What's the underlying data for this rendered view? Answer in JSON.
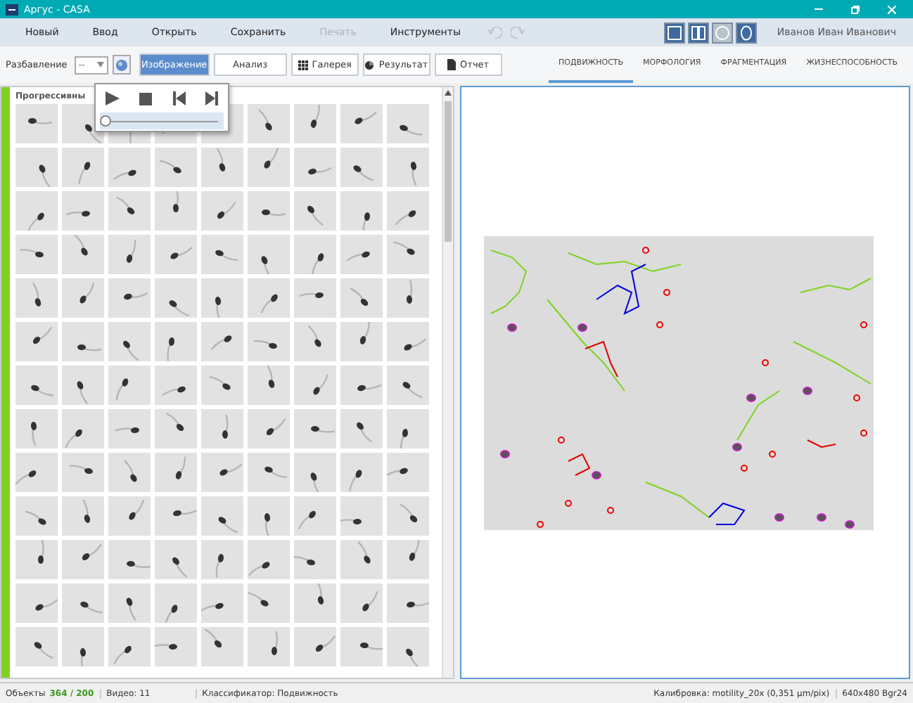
{
  "window": {
    "title": "Аргус - CASA"
  },
  "menu": [
    {
      "label": "Новый",
      "disabled": false
    },
    {
      "label": "Ввод",
      "disabled": false
    },
    {
      "label": "Открыть",
      "disabled": false
    },
    {
      "label": "Сохранить",
      "disabled": false
    },
    {
      "label": "Печать",
      "disabled": true
    },
    {
      "label": "Инструменты",
      "disabled": false
    }
  ],
  "history": {
    "undo_disabled": true,
    "redo_disabled": true
  },
  "view_modes": [
    {
      "kind": "single",
      "selected": true
    },
    {
      "kind": "split",
      "selected": true
    },
    {
      "kind": "circle",
      "selected": false
    },
    {
      "kind": "oval",
      "selected": true
    }
  ],
  "user": "Иванов Иван Иванович",
  "toolbar": {
    "dilution_label": "Разбавление",
    "dilution_value": "--",
    "buttons": [
      {
        "label": "Изображение",
        "kind": "plain",
        "selected": true
      },
      {
        "label": "Анализ",
        "kind": "plain",
        "selected": false
      },
      {
        "label": "Галерея",
        "kind": "grid",
        "selected": false
      },
      {
        "label": "Результат",
        "kind": "pie",
        "selected": false
      },
      {
        "label": "Отчет",
        "kind": "doc",
        "selected": false
      }
    ]
  },
  "tabs": [
    {
      "label": "ПОДВИЖНОСТЬ",
      "selected": true
    },
    {
      "label": "МОРФОЛОГИЯ",
      "selected": false
    },
    {
      "label": "ФРАГМЕНТАЦИЯ",
      "selected": false
    },
    {
      "label": "ЖИЗНЕСПОСОБНОСТЬ",
      "selected": false
    }
  ],
  "gallery": {
    "header": "Прогрессивны"
  },
  "player": {
    "level": 0
  },
  "status_bar": {
    "objects_label": "Объекты",
    "objects_value": "364 / 200",
    "video": "Видео: 11",
    "classifier": "Классификатор: Подвижность",
    "calibration": "Калибровка: motility_20x (0,351 µm/pix)",
    "format": "640x480 Bgr24"
  }
}
